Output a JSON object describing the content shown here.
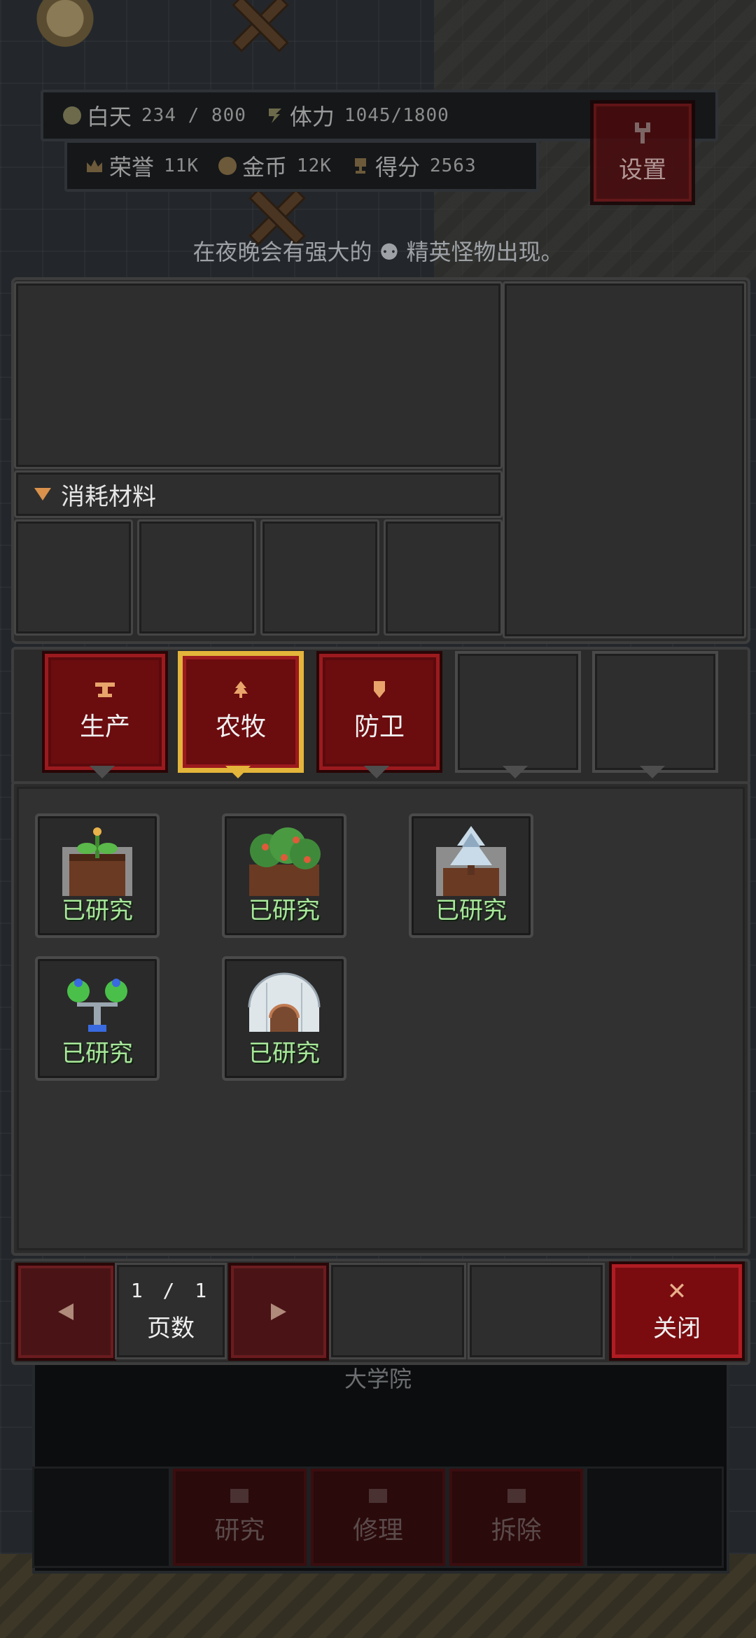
{
  "hud": {
    "daytime_label": "白天",
    "daytime_value": "234 / 800",
    "stamina_label": "体力",
    "stamina_value": "1045/1800",
    "honor_label": "荣誉",
    "honor_value": "11K",
    "gold_label": "金币",
    "gold_value": "12K",
    "score_label": "得分",
    "score_value": "2563",
    "settings_label": "设置"
  },
  "notice": "在夜晚会有强大的 ⚉ 精英怪物出现。",
  "research": {
    "materials_label": "消耗材料",
    "tabs": [
      {
        "label": "生产",
        "icon": "anvil-icon"
      },
      {
        "label": "农牧",
        "icon": "tree-icon"
      },
      {
        "label": "防卫",
        "icon": "shield-icon"
      }
    ],
    "selected_tab": "农牧",
    "items": [
      {
        "name": "planter",
        "status": "已研究"
      },
      {
        "name": "fruit-bush",
        "status": "已研究"
      },
      {
        "name": "snow-pine",
        "status": "已研究"
      },
      {
        "name": "potion-sprinkler",
        "status": "已研究"
      },
      {
        "name": "igloo",
        "status": "已研究"
      }
    ]
  },
  "pager": {
    "page_number": "1 / 1",
    "page_label": "页数",
    "close_label": "关闭"
  },
  "building": {
    "title": "大学院",
    "actions": [
      "研究",
      "修理",
      "拆除"
    ]
  },
  "colors": {
    "accent_red": "#7a0c10",
    "selected_gold": "#e3b53a",
    "researched_green": "#a8e89a"
  }
}
